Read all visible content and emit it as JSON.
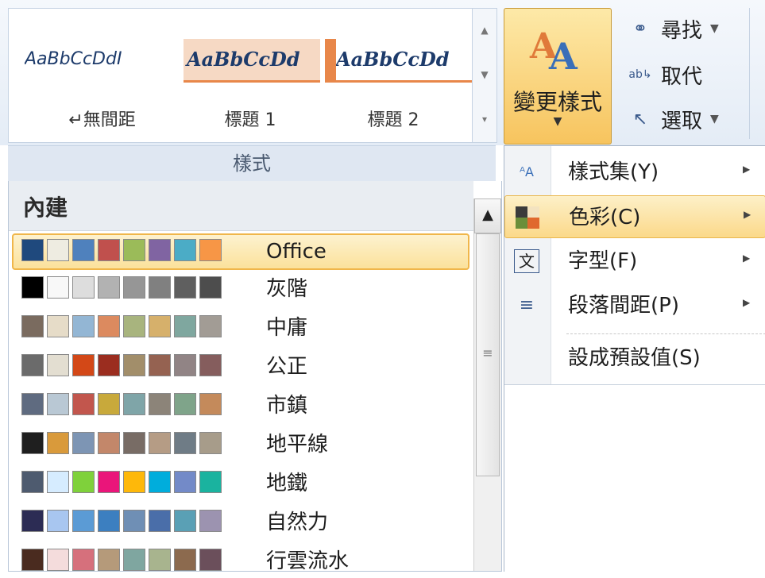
{
  "ribbon": {
    "gallery_tiles": [
      {
        "sample": "AaBbCcDdI",
        "caption": "↵無間距"
      },
      {
        "sample": "AaBbCcDd",
        "caption": "標題 1"
      },
      {
        "sample": "AaBbCcDd",
        "caption": "標題 2"
      }
    ],
    "group_label": "樣式",
    "change_styles": {
      "label": "變更樣式",
      "icon": "change-styles-icon"
    },
    "editing": [
      {
        "label": "尋找",
        "icon": "binoculars-icon",
        "has_dropdown": true
      },
      {
        "label": "取代",
        "icon": "replace-icon",
        "has_dropdown": false
      },
      {
        "label": "選取",
        "icon": "cursor-icon",
        "has_dropdown": true
      }
    ]
  },
  "colors_gallery": {
    "section_title": "內建",
    "themes": [
      {
        "name": "Office",
        "selected": true,
        "colors": [
          "#1f497d",
          "#eeece1",
          "#4f81bd",
          "#c0504d",
          "#9bbb59",
          "#8064a2",
          "#4bacc6",
          "#f79646"
        ]
      },
      {
        "name": "灰階",
        "selected": false,
        "colors": [
          "#000000",
          "#f8f8f8",
          "#dddddd",
          "#b2b2b2",
          "#969696",
          "#808080",
          "#5f5f5f",
          "#4d4d4d"
        ]
      },
      {
        "name": "中庸",
        "selected": false,
        "colors": [
          "#7a6b5f",
          "#e6dcc8",
          "#93b6d4",
          "#dc8a5f",
          "#a8b47e",
          "#d6b06b",
          "#7fa79f",
          "#a29c95"
        ]
      },
      {
        "name": "公正",
        "selected": false,
        "colors": [
          "#6b6b6b",
          "#e3ded1",
          "#d34817",
          "#9b2d1f",
          "#a28e6a",
          "#956251",
          "#918485",
          "#855d5d"
        ]
      },
      {
        "name": "市鎮",
        "selected": false,
        "colors": [
          "#5f6b80",
          "#b9c8d4",
          "#c2564d",
          "#c8a93b",
          "#7fa5a8",
          "#8c8479",
          "#7fa48a",
          "#c48a5b"
        ]
      },
      {
        "name": "地平線",
        "selected": false,
        "colors": [
          "#1f1f1f",
          "#d99a3b",
          "#7d95b4",
          "#c3876a",
          "#786c65",
          "#b59c85",
          "#6f7c86",
          "#a79c8a"
        ]
      },
      {
        "name": "地鐵",
        "selected": false,
        "colors": [
          "#4e5b6f",
          "#d6ecff",
          "#7fd13b",
          "#ea157a",
          "#feb80a",
          "#00addc",
          "#738ac8",
          "#1ab39f"
        ]
      },
      {
        "name": "自然力",
        "selected": false,
        "colors": [
          "#2c2c54",
          "#a8c6f0",
          "#5b9bd5",
          "#3c7fc0",
          "#6f8fb5",
          "#4a6ea9",
          "#5aa0b5",
          "#9c93b0"
        ]
      },
      {
        "name": "行雲流水",
        "selected": false,
        "colors": [
          "#4a2b1f",
          "#f4dcdc",
          "#d6707c",
          "#b59a7a",
          "#7fa6a0",
          "#a8b48e",
          "#8c6a4e",
          "#6b4f5b"
        ]
      }
    ]
  },
  "menu": {
    "items": [
      {
        "label": "樣式集(Y)",
        "icon": "style-set-icon",
        "has_submenu": true,
        "highlighted": false
      },
      {
        "label": "色彩(C)",
        "icon": "colors-icon",
        "has_submenu": true,
        "highlighted": true
      },
      {
        "label": "字型(F)",
        "icon": "fonts-icon",
        "has_submenu": true,
        "highlighted": false
      },
      {
        "label": "段落間距(P)",
        "icon": "paragraph-spacing-icon",
        "has_submenu": true,
        "highlighted": false
      },
      {
        "label": "設成預設值(S)",
        "icon": "",
        "has_submenu": false,
        "highlighted": false
      }
    ]
  }
}
